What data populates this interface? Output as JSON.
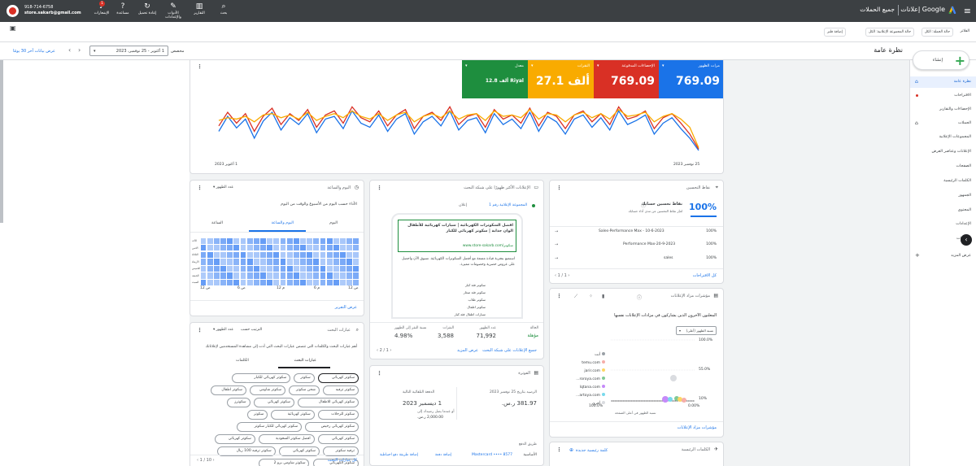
{
  "topbar": {
    "app_name": "إعلانات Google",
    "section": "جميع الحملات",
    "account_phone": "918-714-6758",
    "account_email": "store.sakarb@gmail.com",
    "badge_count": "1",
    "tools": [
      {
        "label": "بحث",
        "icon": "search-icon"
      },
      {
        "label": "التقارير",
        "icon": "reports-icon"
      },
      {
        "label": "الأدوات والإعدادات",
        "icon": "wrench-icon"
      },
      {
        "label": "إعادة تحميل",
        "icon": "refresh-icon"
      },
      {
        "label": "مساعدة",
        "icon": "help-icon"
      },
      {
        "label": "الإشعارات",
        "icon": "bell-icon"
      }
    ]
  },
  "subbar": {
    "filters_label": "الفلاتر",
    "pill_campaign_status": "حالة الحملة: الكل",
    "pill_adgroup_status": "حالة المجموعة الإعلانية: الكل",
    "pill_add_filter": "إضافة فلتر"
  },
  "filterbar": {
    "page_title": "نظرة عامة",
    "date_label": "مخصص",
    "date_range": "1 أكتوبر - 25 نوفمبر، 2023",
    "show_last_30": "عرض بيانات آخر 30 يومًا"
  },
  "nav": {
    "new_button": "إنشاء",
    "items": [
      {
        "label": "نظرة عامة",
        "active": true
      },
      {
        "label": "الاقتراحات"
      },
      {
        "label": "الإحصاءات والتقارير"
      },
      {
        "label": "الحملات"
      },
      {
        "label": "المجموعات الإعلانية"
      },
      {
        "label": "الإعلانات وعناصر العرض"
      },
      {
        "label": "الصفحات"
      },
      {
        "label": "الكلمات الرئيسية"
      },
      {
        "label": "الجمهور"
      },
      {
        "label": "المحتوى"
      },
      {
        "label": "الإعدادات"
      },
      {
        "label": "التغييرات"
      }
    ],
    "show_more": "عرض المزيد"
  },
  "metrics": [
    {
      "label": "مرات الظهور",
      "value": "769.09",
      "color": "#1a73e8"
    },
    {
      "label": "الإحصاءات المدفوعة",
      "value": "769.09",
      "color": "#d93025"
    },
    {
      "label": "النقرات",
      "value": "27.1 ألف",
      "color": "#f9ab00"
    },
    {
      "label": "معدل",
      "value": "12.8 ألف Riyal",
      "color": "#1e8e3e"
    }
  ],
  "main_chart": {
    "x_start": "1 أكتوبر 2023",
    "x_end": "25 نوفمبر 2023",
    "series": [
      {
        "color": "#1a73e8",
        "values": [
          40,
          62,
          45,
          58,
          30,
          55,
          68,
          42,
          60,
          50,
          66,
          38,
          58,
          62,
          44,
          70,
          52,
          46,
          64,
          40,
          58,
          66,
          36,
          54,
          62,
          48,
          70,
          42,
          56,
          60,
          38,
          66,
          50,
          58,
          44,
          68,
          40,
          62,
          54,
          36,
          58,
          64,
          46,
          60,
          42,
          70,
          50,
          56,
          64,
          36,
          52,
          60,
          44,
          30,
          12
        ]
      },
      {
        "color": "#d93025",
        "values": [
          48,
          68,
          52,
          66,
          40,
          62,
          74,
          50,
          66,
          56,
          72,
          46,
          64,
          70,
          52,
          76,
          60,
          54,
          70,
          48,
          64,
          72,
          44,
          62,
          68,
          56,
          76,
          50,
          62,
          66,
          46,
          72,
          58,
          64,
          52,
          74,
          48,
          68,
          62,
          44,
          64,
          70,
          54,
          66,
          50,
          76,
          58,
          62,
          70,
          44,
          60,
          66,
          52,
          36,
          14
        ]
      },
      {
        "color": "#f9ab00",
        "values": [
          56,
          60,
          58,
          62,
          54,
          64,
          66,
          60,
          64,
          58,
          68,
          56,
          62,
          66,
          60,
          70,
          62,
          58,
          66,
          56,
          64,
          68,
          54,
          62,
          66,
          60,
          70,
          58,
          64,
          66,
          56,
          70,
          62,
          64,
          60,
          72,
          58,
          66,
          64,
          54,
          64,
          68,
          60,
          66,
          58,
          72,
          62,
          64,
          68,
          54,
          62,
          66,
          58,
          46,
          16
        ]
      }
    ]
  },
  "hours_card": {
    "title": "اليوم والساعة",
    "selector": "عدد الظهور",
    "subtitle": "الأداء حسب اليوم من الأسبوع والوقت من اليوم",
    "tabs": [
      "اليوم",
      "اليوم والساعة",
      "الساعة"
    ],
    "days": [
      "الأحد",
      "الاثنين",
      "الثلاثاء",
      "الأربعاء",
      "الخميس",
      "الجمعة",
      "السبت"
    ],
    "x_ticks": [
      "12 ص",
      "6 ص",
      "12 م",
      "6 م",
      "12 ص"
    ],
    "link": "عرض التقرير"
  },
  "search_card": {
    "title": "عبارات البحث",
    "selector": "عدد الظهور",
    "selector2": "الترتيب حسب",
    "subtitle": "أهم عبارات البحث والكلمات التي تتضمن عبارات البحث التي أدت إلى مشاهدة المستخدمين لإعلاناتك",
    "tabs": [
      "عبارات البحث",
      "الكلمات"
    ],
    "chips": [
      "سكوتر كهربائي",
      "سكوتر",
      "سكوتر كهربائي للكبار",
      "سكوتر ترفيه",
      "شحن سكوتر",
      "سكوتر شاومي",
      "سكوتر اطفال",
      "سكوتر كهربائي للاطفال",
      "سكوتر كهربائي",
      "سكوترز",
      "سكوتر للرحلات",
      "سكوتر كهربائية",
      "سكوتر",
      "سكوتر كهربائي رخيص",
      "سكوتر كهربائي للكبار سكوتر",
      "سكوتر كهربائي",
      "افضل سكوتر السعودية",
      "سكوتر كهربائي",
      "ترفيه سكوتر",
      "سكوتر كهربائي",
      "سكوتر ترفيه 100 ريال",
      "سكوتر الكهربائي",
      "سكوتر شاومي برو 2"
    ],
    "pager": "1 / 10",
    "link": "كل عبارات البحث"
  },
  "ads_card": {
    "title": "الإعلانات الأكثر ظهورًا على شبكة البحث",
    "adgroup": "المجموعة الإعلانية رقم 1",
    "status": "إعلان",
    "ad_headline": "افضل السكوترات الكهربائية | سيارات كهربائية للأطفال الوان جذابة | سكوتر كهربائي للكبار",
    "ad_url": "www.store-sakarb.com/سكوتر",
    "ad_desc": "استمتع بتجربة قيادة ممتعة مع أفضل السكوترات الكهربائية. تسوق الآن واحصل على عروض حصرية وخصومات مميزة.",
    "ad_links": [
      "سكوتر فئة كبار",
      "سكوتر فئة صغار",
      "سكوتر طلاب",
      "سكوتر اطفال",
      "سيارات اطفال فئة كبار"
    ],
    "stats_labels": [
      "الحالة",
      "عدد الظهور",
      "النقرات",
      "نسبة النقر إلى الظهور"
    ],
    "stats_values": [
      "مؤهلة",
      "71,992",
      "3,588",
      "4.98%"
    ],
    "pager": "2 / 1",
    "link": "جميع الإعلانات على شبكة البحث",
    "link2": "عرض المزيد"
  },
  "opt_card": {
    "title": "نقاط التحسين",
    "score_label": "نقاط تحسين حسابك",
    "score": "100%",
    "score_desc": "تُعبّر نقاط التحسين عن مدى أداء حسابك",
    "rows": [
      {
        "name": "Sales-Performance Max - 10-6-2023",
        "value": "100%"
      },
      {
        "name": "Performance Max-20-9-2023",
        "value": "100%"
      },
      {
        "name": "sales",
        "value": "100%"
      }
    ],
    "pager": "1 / 1",
    "link": "كل الاقتراحات"
  },
  "auction_card": {
    "title": "مؤشرات مزاد الإعلانات",
    "subtitle": "المعلنون الآخرون الذين يشاركون في مزادات الإعلانات نفسها",
    "selector": "نسبة الظهور (أعلى)",
    "y_ticks": [
      "100.0%",
      "55.0%",
      "10%"
    ],
    "x_ticks": [
      "100.0%",
      "0.00%"
    ],
    "x_label": "نسبة الظهور في أعلى الصفحة",
    "domains": [
      {
        "name": "أنت",
        "color": "#9aa0a6"
      },
      {
        "name": "temu.com",
        "color": "#f6aea9"
      },
      {
        "name": "jarir.com",
        "color": "#fdd663"
      },
      {
        "name": "...roroya.com",
        "color": "#81c995"
      },
      {
        "name": "lqtana.com",
        "color": "#c58af9"
      },
      {
        "name": "...artoya.com",
        "color": "#78d9ec"
      },
      {
        "name": "أخرى",
        "color": "#dadce0"
      }
    ],
    "link": "مؤشرات مزاد الإعلانات"
  },
  "billing_card": {
    "title": "الفوترة",
    "last_payment_label": "الدفعة التلقائية التالية",
    "last_payment_date": "1 ديسمبر 2023",
    "last_payment_note": "أو عندما يصل رصيدك إلى",
    "threshold": "2,000.00 ر.س.",
    "balance_label": "الرصيد بتاريخ 25 نوفمبر 2023",
    "balance": "381.97 ر.س.",
    "method_label": "طريق الدفع",
    "method_value": "Mastercard •••• 8577",
    "method_tag": "الأساسية",
    "link_add": "إضافة طريقة دفع احتياطية",
    "link_settle": "إضافة دفعة"
  },
  "keywords_card": {
    "title": "الكلمات الرئيسية",
    "selector": "كلمة رئيسية جديدة"
  }
}
